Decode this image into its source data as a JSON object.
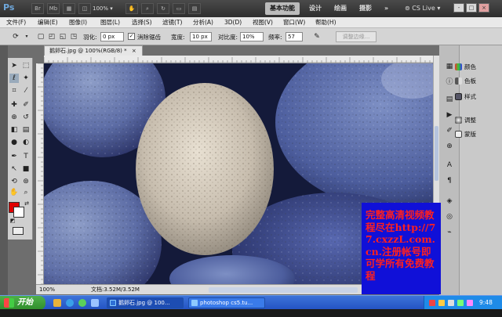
{
  "app": {
    "logo": "Ps"
  },
  "titlebar": {
    "buttons": [
      "Br",
      "Mb"
    ],
    "zoom": "100%",
    "workspaces": [
      "基本功能",
      "设计",
      "绘画",
      "摄影"
    ],
    "more": "»",
    "cs_live": "CS Live",
    "win_controls": [
      "-",
      "□",
      "×"
    ]
  },
  "menu": [
    "文件(F)",
    "编辑(E)",
    "图像(I)",
    "图层(L)",
    "选择(S)",
    "滤镜(T)",
    "分析(A)",
    "3D(D)",
    "视图(V)",
    "窗口(W)",
    "帮助(H)"
  ],
  "options": {
    "feather_label": "羽化:",
    "feather_value": "0 px",
    "antialias_label": "消除锯齿",
    "antialias_checked": "✓",
    "width_label": "宽度:",
    "width_value": "10 px",
    "contrast_label": "对比度:",
    "contrast_value": "10%",
    "frequency_label": "频率:",
    "frequency_value": "57",
    "refine_button": "调整边缘..."
  },
  "document": {
    "tab_title": "鹅卵石.jpg @ 100%(RGB/8) *",
    "close": "×",
    "zoom_status": "100%",
    "doc_info": "文档:3.52M/3.52M"
  },
  "colors": {
    "foreground": "#e00000",
    "background": "#ffffff"
  },
  "panels": {
    "items": [
      "颜色",
      "色板",
      "样式",
      "调整",
      "蒙版"
    ]
  },
  "overlay": {
    "text": "完整高清视频教程尽在http://77.cxzzL.com.cn.注册帐号即可学所有免费教程"
  },
  "taskbar": {
    "start": "开始",
    "tasks": [
      "鹅卵石.jpg @ 100...",
      "photoshop cs5.tu..."
    ],
    "clock": "9:48"
  }
}
